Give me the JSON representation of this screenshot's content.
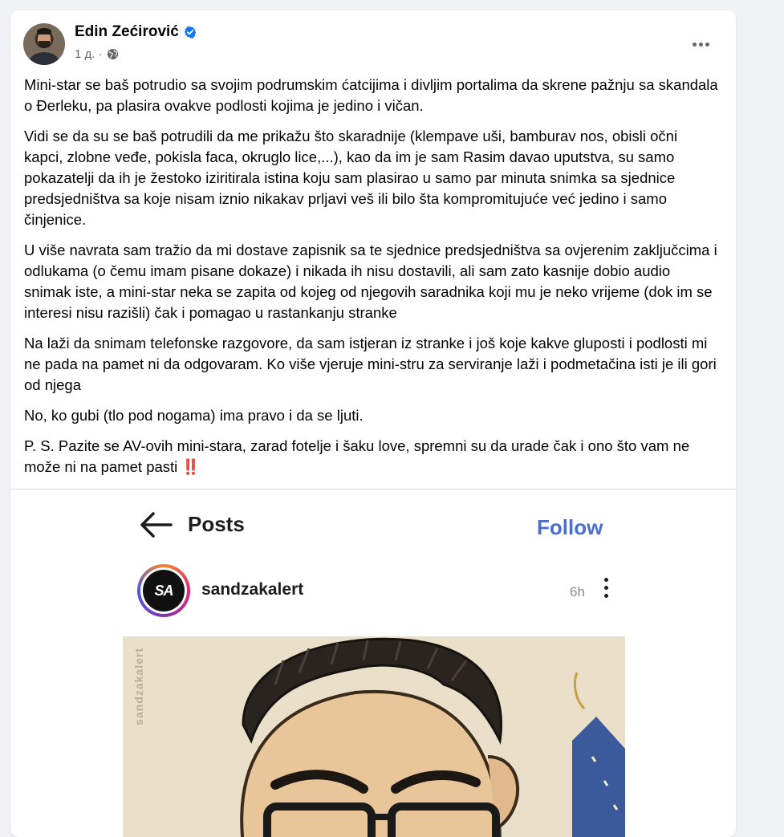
{
  "post": {
    "author": "Edin Zećirović",
    "time": "1 д. ·",
    "paragraphs": [
      "Mini-star se baš potrudio sa svojim podrumskim ćatcijima i divljim portalima da skrene pažnju sa skandala o Đerleku, pa plasira ovakve podlosti kojima je jedino i vičan.",
      "Vidi se da su se baš potrudili da me prikažu što skaradnije (klempave uši, bamburav nos, obisli očni kapci, zlobne veđe, pokisla faca, okruglo lice,...), kao da im je sam Rasim davao uputstva, su samo pokazatelji da ih je žestoko iziritirala istina koju sam plasirao u samo par minuta snimka sa sjednice predsjedništva sa koje nisam iznio nikakav prljavi veš ili bilo šta kompromitujuće već jedino i samo činjenice.",
      "U više navrata sam tražio da mi dostave zapisnik sa te sjednice predsjedništva sa ovjerenim zaključcima i odlukama (o čemu imam pisane dokaze) i nikada ih nisu dostavili, ali sam zato kasnije dobio audio snimak iste, a mini-star neka se zapita od kojeg od njegovih saradnika koji mu je neko vrijeme (dok im se interesi nisu razišli) čak i pomagao u rastankanju stranke",
      "Na laži da snimam telefonske razgovore, da sam istjeran iz stranke i još koje kakve gluposti i podlosti mi ne pada na pamet ni da odgovaram. Ko više vjeruje mini-stru za serviranje laži i podmetačina isti je ili gori od njega",
      "No, ko gubi (tlo pod nogama) ima pravo i da se ljuti.",
      "P. S. Pazite se AV-ovih mini-stara, zarad fotelje i šaku love, spremni su da urade čak i ono što vam ne može ni na pamet pasti"
    ],
    "emoji": "‼️"
  },
  "screenshot": {
    "title": "Posts",
    "follow": "Follow",
    "username": "sandzakalert",
    "logo_text": "SA",
    "time": "6h",
    "watermark": "sandzakalert"
  },
  "colors": {
    "verified": "#1877f2",
    "follow": "#4a6fd1",
    "emoji": "#e0242f"
  },
  "icons": [
    "verified-badge-icon",
    "globe-icon",
    "more-options-icon",
    "back-arrow-icon",
    "vertical-dots-icon"
  ]
}
